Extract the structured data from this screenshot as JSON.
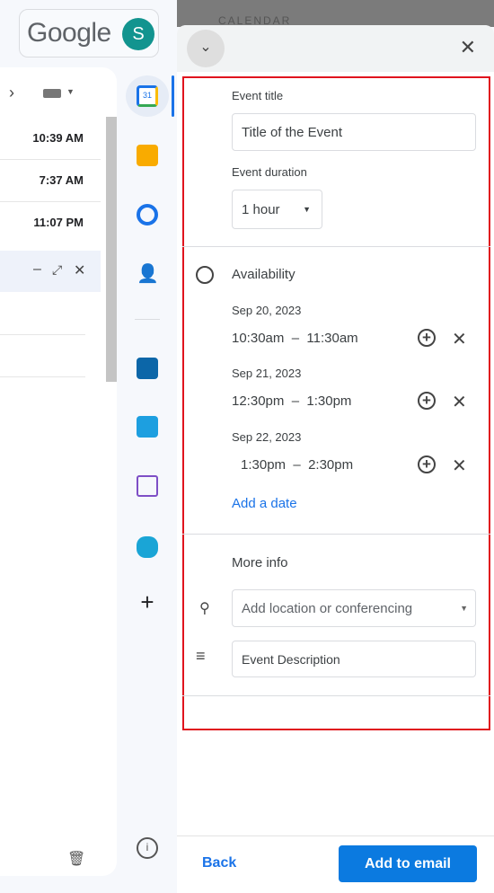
{
  "header": {
    "logo": "Google",
    "avatar_letter": "S"
  },
  "mail": {
    "times": [
      "10:39 AM",
      "7:37 AM",
      "11:07 PM"
    ]
  },
  "sidebar": {
    "icons": [
      "google-calendar-icon",
      "google-keep-icon",
      "google-tasks-icon",
      "google-contacts-icon",
      "trello-icon",
      "bot-addon-icon",
      "notes-addon-icon",
      "printer-addon-icon",
      "add-addon-icon",
      "info-icon"
    ]
  },
  "panel": {
    "bg_title": "CALENDAR",
    "event_title_label": "Event title",
    "event_title_value": "Title of the Event",
    "duration_label": "Event duration",
    "duration_value": "1 hour",
    "availability_label": "Availability",
    "slots": [
      {
        "date": "Sep 20, 2023",
        "start": "10:30am",
        "end": "11:30am"
      },
      {
        "date": "Sep 21, 2023",
        "start": "12:30pm",
        "end": "1:30pm"
      },
      {
        "date": "Sep 22, 2023",
        "start": "1:30pm",
        "end": "2:30pm"
      }
    ],
    "add_date": "Add a date",
    "more_info_label": "More info",
    "location_placeholder": "Add location or conferencing",
    "description_value": "Event Description",
    "back": "Back",
    "add_to_email": "Add to email"
  },
  "colors": {
    "accent": "#1a73e8",
    "button": "#0b7ae0",
    "highlight_box": "#e0141e"
  }
}
